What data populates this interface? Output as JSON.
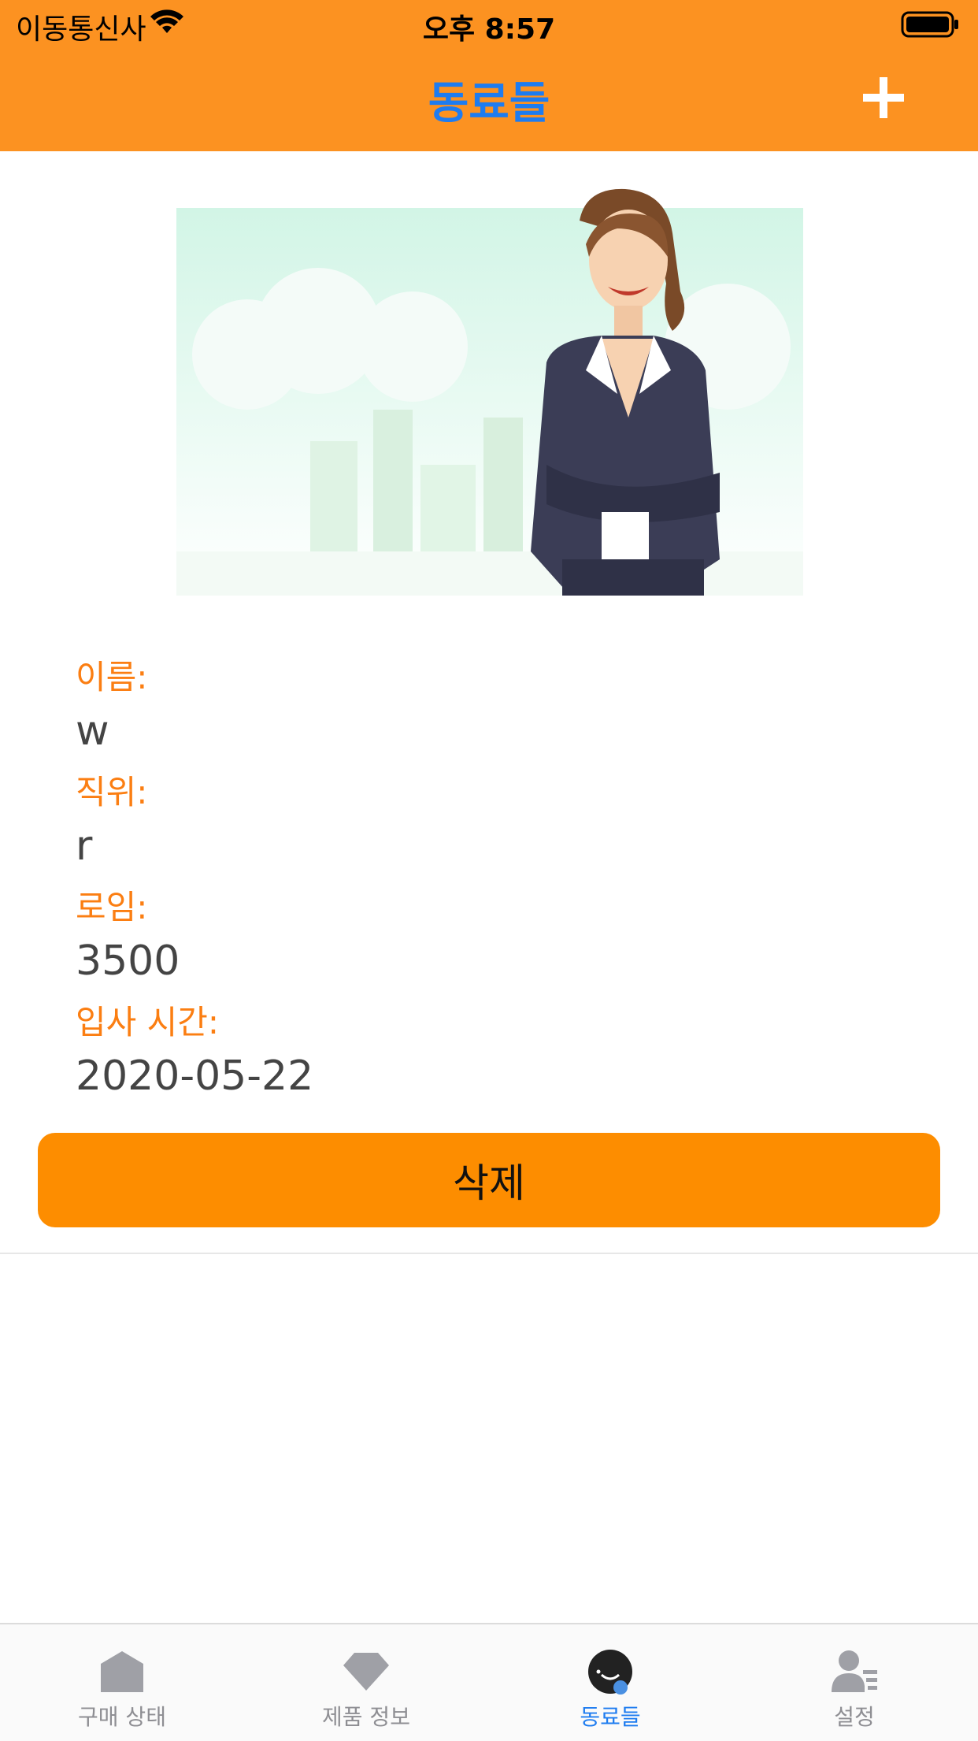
{
  "status_bar": {
    "carrier": "이동통신사",
    "time": "오후 8:57"
  },
  "nav": {
    "title": "동료들",
    "add_icon": "plus-icon"
  },
  "colors": {
    "accent_orange": "#fc9221",
    "label_orange": "#fb7e12",
    "button_orange": "#fd8d00",
    "active_blue": "#1e7cf0",
    "inactive_gray": "#8e8e93"
  },
  "details": {
    "name_label": "이름:",
    "name_value": "w",
    "position_label": "직위:",
    "position_value": "r",
    "salary_label": "로임:",
    "salary_value": "3500",
    "join_label": "입사 시간:",
    "join_value": "2020-05-22"
  },
  "actions": {
    "delete_label": "삭제"
  },
  "tabs": [
    {
      "label": "구매 상태",
      "icon": "home-icon",
      "active": false
    },
    {
      "label": "제품 정보",
      "icon": "diamond-icon",
      "active": false
    },
    {
      "label": "동료들",
      "icon": "smile-icon",
      "active": true
    },
    {
      "label": "설정",
      "icon": "user-settings-icon",
      "active": false
    }
  ]
}
